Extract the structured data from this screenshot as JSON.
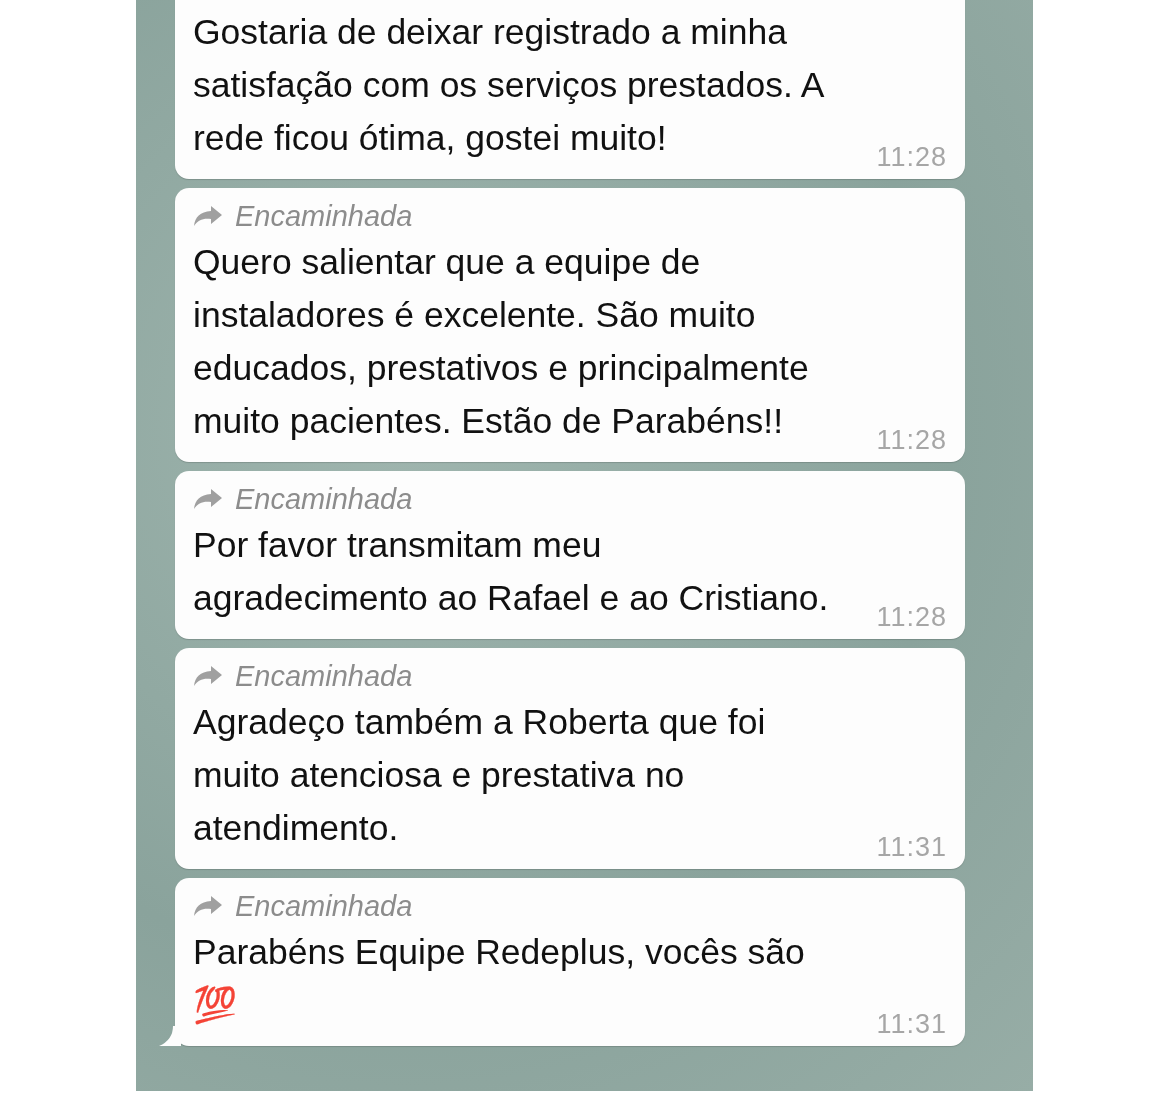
{
  "messages": [
    {
      "forwarded": false,
      "lines": [
        "Gostaria de deixar registrado a minha",
        "satisfação com os serviços prestados. A",
        "rede ficou ótima, gostei muito!"
      ],
      "time": "11:28",
      "tail": false
    },
    {
      "forwarded": true,
      "forward_label": "Encaminhada",
      "lines": [
        "Quero salientar que a equipe de",
        "instaladores é excelente.  São muito",
        "educados, prestativos e principalmente",
        "muito pacientes. Estão de Parabéns!!"
      ],
      "time": "11:28",
      "tail": false
    },
    {
      "forwarded": true,
      "forward_label": "Encaminhada",
      "lines": [
        "Por favor transmitam meu",
        "agradecimento ao Rafael e ao Cristiano."
      ],
      "time": "11:28",
      "tail": false
    },
    {
      "forwarded": true,
      "forward_label": "Encaminhada",
      "lines": [
        "Agradeço também a Roberta que foi",
        "muito atenciosa e prestativa no",
        "atendimento."
      ],
      "time": "11:31",
      "tail": false
    },
    {
      "forwarded": true,
      "forward_label": "Encaminhada",
      "lines": [
        "Parabéns Equipe Redeplus, vocês são",
        "💯"
      ],
      "time": "11:31",
      "tail": true
    }
  ]
}
